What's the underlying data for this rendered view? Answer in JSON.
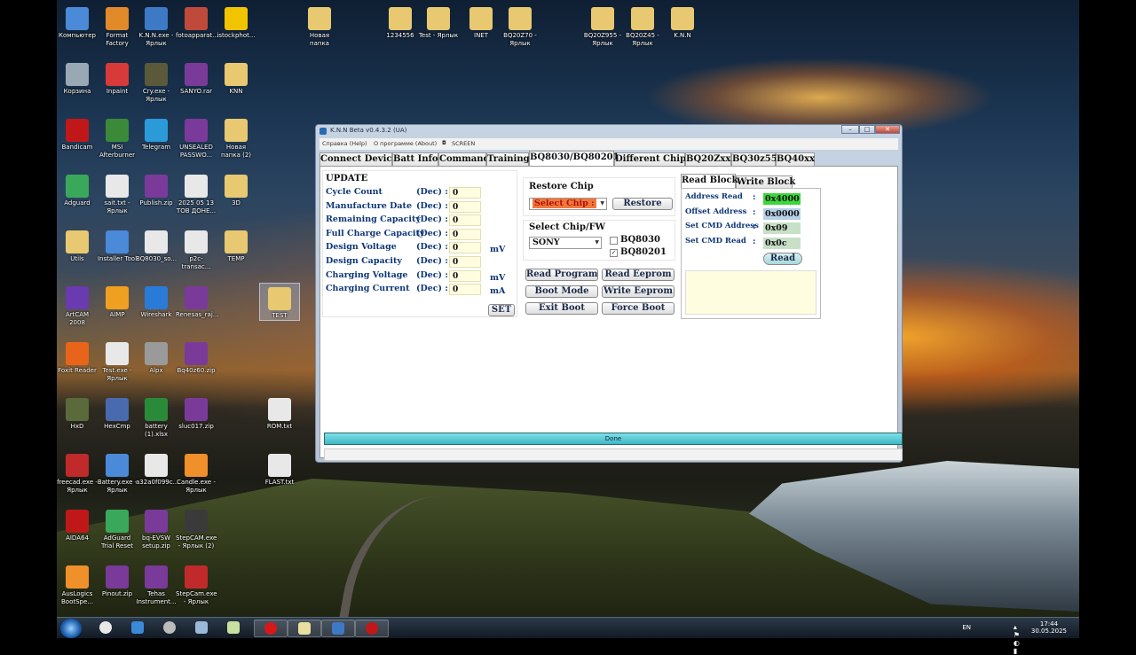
{
  "desktop_icons": [
    {
      "label": "Компьютер",
      "color": "#4a8ad8"
    },
    {
      "label": "Format Factory",
      "color": "#e08a2a"
    },
    {
      "label": "K.N.N.exe - Ярлык",
      "color": "#3d79c4"
    },
    {
      "label": "fotoapparat...",
      "color": "#c04a3a"
    },
    {
      "label": "istockphot...",
      "color": "#f2c400"
    },
    {
      "label": "Новая папка",
      "color": "#e8c870"
    },
    {
      "label": "1234556",
      "color": "#e8c870"
    },
    {
      "label": "Test - Ярлык",
      "color": "#e8c870"
    },
    {
      "label": "INET",
      "color": "#e8c870"
    },
    {
      "label": "BQ20Z70 - Ярлык",
      "color": "#e8c870"
    },
    {
      "label": "BQ20Z955 - Ярлык",
      "color": "#e8c870"
    },
    {
      "label": "BQ20Z45 - Ярлык",
      "color": "#e8c870"
    },
    {
      "label": "K.N.N",
      "color": "#e8c870"
    },
    {
      "label": "Корзина",
      "color": "#9aa8b4"
    },
    {
      "label": "Inpaint",
      "color": "#d83a3a"
    },
    {
      "label": "Cry.exe - Ярлык",
      "color": "#5a5a3a"
    },
    {
      "label": "SANYO.rar",
      "color": "#7a3a9a"
    },
    {
      "label": "KNN",
      "color": "#e8c870"
    },
    {
      "label": "Bandicam",
      "color": "#c01818"
    },
    {
      "label": "MSI Afterburner",
      "color": "#3a8a3a"
    },
    {
      "label": "Telegram",
      "color": "#2a9ad8"
    },
    {
      "label": "UNSEALED PASSWO...",
      "color": "#7a3a9a"
    },
    {
      "label": "Новая папка (2)",
      "color": "#e8c870"
    },
    {
      "label": "Adguard",
      "color": "#3aa85a"
    },
    {
      "label": "sait.txt - Ярлык",
      "color": "#e8e8e8"
    },
    {
      "label": "Publish.zip",
      "color": "#7a3a9a"
    },
    {
      "label": "2025 05 13 ТОВ ДОНЕ...",
      "color": "#e8e8e8"
    },
    {
      "label": "3D",
      "color": "#e8c870"
    },
    {
      "label": "Utils",
      "color": "#e8c870"
    },
    {
      "label": "Installer Tool",
      "color": "#4a8ad8"
    },
    {
      "label": "BQ8030_so...",
      "color": "#e8e8e8"
    },
    {
      "label": "p2c-transac...",
      "color": "#e8e8e8"
    },
    {
      "label": "TEMP",
      "color": "#e8c870"
    },
    {
      "label": "TEST",
      "color": "#e8c870"
    },
    {
      "label": "ArtCAM 2008",
      "color": "#6a3ab0"
    },
    {
      "label": "AIMP",
      "color": "#f0a020"
    },
    {
      "label": "Wireshark",
      "color": "#2a7ad8"
    },
    {
      "label": "Renesas_raj...",
      "color": "#7a3a9a"
    },
    {
      "label": "Foxit Reader",
      "color": "#e8641a"
    },
    {
      "label": "Test.exe - Ярлык",
      "color": "#e8e8e8"
    },
    {
      "label": "Alpx",
      "color": "#9a9a9a"
    },
    {
      "label": "Bq40z60.zip",
      "color": "#7a3a9a"
    },
    {
      "label": "HxD",
      "color": "#5a6a3a"
    },
    {
      "label": "HexCmp",
      "color": "#4a6ab0"
    },
    {
      "label": "battery (1).xlsx",
      "color": "#2a8a3a"
    },
    {
      "label": "sluc017.zip",
      "color": "#7a3a9a"
    },
    {
      "label": "ROM.txt",
      "color": "#e8e8e8"
    },
    {
      "label": "freecad.exe - Ярлык",
      "color": "#c02a2a"
    },
    {
      "label": "Battery.exe - Ярлык",
      "color": "#4a8ad8"
    },
    {
      "label": "a32a0f099c...",
      "color": "#e8e8e8"
    },
    {
      "label": "Candle.exe - Ярлык",
      "color": "#f0902a"
    },
    {
      "label": "FLAST.txt",
      "color": "#e8e8e8"
    },
    {
      "label": "AIDA64",
      "color": "#c01818"
    },
    {
      "label": "AdGuard Trial Reset",
      "color": "#3aa85a"
    },
    {
      "label": "bq-EVSW setup.zip",
      "color": "#7a3a9a"
    },
    {
      "label": "StepCAM.exe - Ярлык (2)",
      "color": "#3a3a3a"
    },
    {
      "label": "AusLogics BootSpe...",
      "color": "#f0902a"
    },
    {
      "label": "Pinout.zip",
      "color": "#7a3a9a"
    },
    {
      "label": "Tehas Instrument...",
      "color": "#7a3a9a"
    },
    {
      "label": "StepCam.exe - Ярлык",
      "color": "#c02a2a"
    }
  ],
  "window": {
    "title": "K.N.N Beta v0.4.3.2 (UA)",
    "minimize": "–",
    "maximize": "□",
    "close": "✕",
    "menu": [
      "Справка (Help)",
      "О программе (About)",
      "SCREEN"
    ]
  },
  "tabs": [
    "Connect Device",
    "Batt Info",
    "Command",
    "Training",
    "BQ8030/BQ80201",
    "Different Chips",
    "BQ20Zxx",
    "BQ30z55",
    "BQ40xx"
  ],
  "update": {
    "header": "UPDATE",
    "rows": [
      {
        "label": "Cycle Count",
        "unit_type": "(Dec) :",
        "value": "0",
        "unit": ""
      },
      {
        "label": "Manufacture Date",
        "unit_type": "(Dec) :",
        "value": "0",
        "unit": ""
      },
      {
        "label": "Remaining Capacity",
        "unit_type": "(Dec) :",
        "value": "0",
        "unit": ""
      },
      {
        "label": "Full Charge Capacity",
        "unit_type": "(Dec) :",
        "value": "0",
        "unit": ""
      },
      {
        "label": "Design Voltage",
        "unit_type": "(Dec) :",
        "value": "0",
        "unit": "mV"
      },
      {
        "label": "Design Capacity",
        "unit_type": "(Dec) :",
        "value": "0",
        "unit": ""
      },
      {
        "label": "Charging Voltage",
        "unit_type": "(Dec) :",
        "value": "0",
        "unit": "mV"
      },
      {
        "label": "Charging Current",
        "unit_type": "(Dec) :",
        "value": "0",
        "unit": "mA"
      }
    ],
    "set_button": "SET"
  },
  "restore": {
    "header": "Restore Chip",
    "select_value": "Select Chip :",
    "restore_button": "Restore",
    "select_bg": "#f07a3a"
  },
  "chipfw": {
    "header": "Select Chip/FW",
    "vendor": "SONY",
    "chk1_label": "BQ8030",
    "chk1_mark": "",
    "chk2_label": "BQ80201",
    "chk2_mark": "✓"
  },
  "actions": {
    "read_program": "Read Program",
    "read_eeprom": "Read Eeprom",
    "boot_mode": "Boot Mode",
    "write_eeprom": "Write Eeprom",
    "exit_boot": "Exit Boot",
    "force_boot": "Force Boot"
  },
  "block": {
    "tab_read": "Read Block",
    "tab_write": "Write Block",
    "rows": [
      {
        "label": "Address Read",
        "sep": ":",
        "value": "0x4000",
        "bg": "#3ad83a"
      },
      {
        "label": "Offset Address",
        "sep": ":",
        "value": "0x0000",
        "bg": "#b8d0e8"
      },
      {
        "label": "Set CMD Address",
        "sep": ":",
        "value": "0x09",
        "bg": "#c8e0c8"
      },
      {
        "label": "Set CMD Read",
        "sep": ":",
        "value": "0x0c",
        "bg": "#c8e0c8"
      }
    ],
    "read_button": "Read"
  },
  "progress": {
    "text": "Done"
  },
  "tray": {
    "lang": "EN",
    "time": "17:44",
    "date": "30.05.2025"
  }
}
